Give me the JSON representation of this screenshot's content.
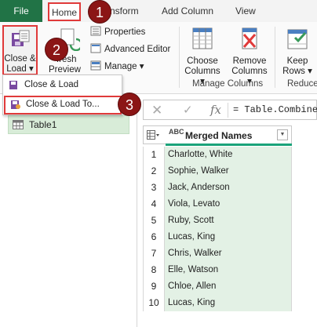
{
  "tabs": {
    "file": "File",
    "home": "Home",
    "transform": "nsform",
    "add_column": "Add Column",
    "view": "View"
  },
  "ribbon": {
    "close_load": {
      "line1": "Close &",
      "line2": "Load"
    },
    "refresh": {
      "line1": "fresh",
      "line2": "Preview"
    },
    "properties": "Properties",
    "advanced_editor": "Advanced Editor",
    "manage": "Manage",
    "choose_columns": {
      "line1": "Choose",
      "line2": "Columns"
    },
    "remove_columns": {
      "line1": "Remove",
      "line2": "Columns"
    },
    "keep_rows": {
      "line1": "Keep",
      "line2": "Rows"
    },
    "group_manage_columns": "Manage Columns",
    "group_reduce": "Reduce"
  },
  "menu": {
    "close_load": "Close & Load",
    "close_load_to": "Close & Load To..."
  },
  "callouts": [
    "1",
    "2",
    "3"
  ],
  "queries": {
    "items": [
      {
        "label": "Table1"
      }
    ]
  },
  "formula_bar": {
    "cancel": "✕",
    "confirm": "✓",
    "fx": "fx",
    "formula": "= Table.Combine"
  },
  "grid": {
    "type_label": "ABC",
    "column_header": "Merged Names",
    "rows": [
      {
        "num": "1",
        "value": "Charlotte, White"
      },
      {
        "num": "2",
        "value": "Sophie, Walker"
      },
      {
        "num": "3",
        "value": "Jack, Anderson"
      },
      {
        "num": "4",
        "value": "Viola, Levato"
      },
      {
        "num": "5",
        "value": "Ruby, Scott"
      },
      {
        "num": "6",
        "value": "Lucas, King"
      },
      {
        "num": "7",
        "value": "Chris, Walker"
      },
      {
        "num": "8",
        "value": "Elle, Watson"
      },
      {
        "num": "9",
        "value": "Chloe, Allen"
      },
      {
        "num": "10",
        "value": "Lucas, King"
      }
    ]
  },
  "colors": {
    "file_tab": "#217346",
    "highlight_border": "#e03a3a",
    "callout": "#8b1515",
    "selected_green": "#e3f1e5",
    "header_underline": "#1aa37a"
  }
}
